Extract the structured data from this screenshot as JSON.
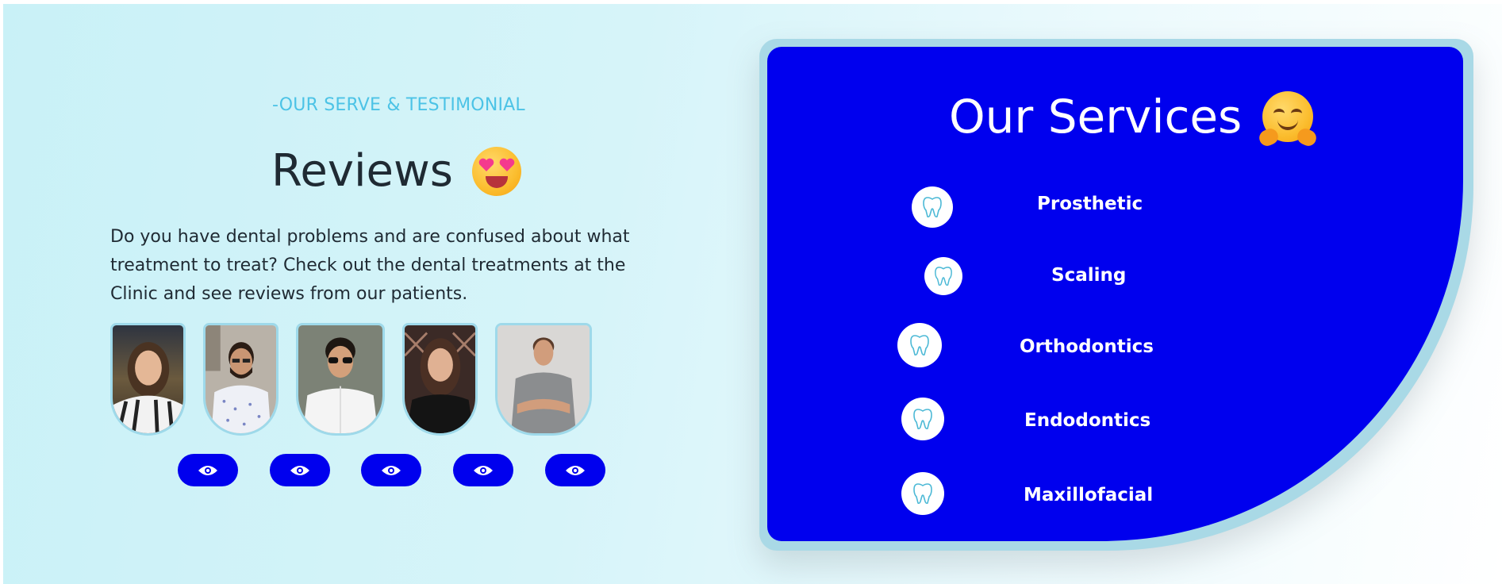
{
  "reviews_section": {
    "eyebrow": "-OUR SERVE & TESTIMONIAL",
    "title": "Reviews",
    "title_emoji": "heart-eyes-emoji",
    "description": "Do you have dental problems and are confused about what treatment to treat? Check out the dental treatments at the Clinic and see reviews from our patients.",
    "patients": [
      {
        "name": "patient-1",
        "icon": "eye-icon"
      },
      {
        "name": "patient-2",
        "icon": "eye-icon"
      },
      {
        "name": "patient-3",
        "icon": "eye-icon"
      },
      {
        "name": "patient-4",
        "icon": "eye-icon"
      },
      {
        "name": "patient-5",
        "icon": "eye-icon"
      }
    ]
  },
  "services_section": {
    "title": "Our Services",
    "title_emoji": "hugging-face-emoji",
    "items": [
      {
        "label": "Prosthetic",
        "icon": "tooth-icon"
      },
      {
        "label": "Scaling",
        "icon": "tooth-icon"
      },
      {
        "label": "Orthodontics",
        "icon": "tooth-icon"
      },
      {
        "label": "Endodontics",
        "icon": "tooth-icon"
      },
      {
        "label": "Maxillofacial",
        "icon": "tooth-icon"
      }
    ]
  },
  "colors": {
    "accent_blue": "#0000ee",
    "eyebrow_cyan": "#4cc3e6",
    "frame_light_blue": "#a9d9e6",
    "text_dark": "#1f2a33"
  }
}
